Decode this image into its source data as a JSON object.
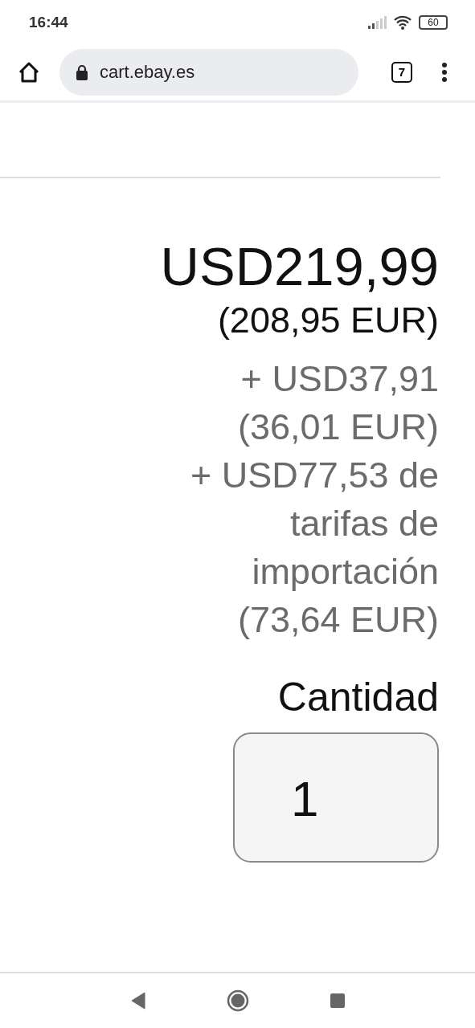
{
  "status_bar": {
    "time": "16:44",
    "battery": "60"
  },
  "browser": {
    "url": "cart.ebay.es",
    "tab_count": "7"
  },
  "item": {
    "price": "USD219,99",
    "price_converted": "(208,95 EUR)",
    "shipping": "+ USD37,91",
    "shipping_converted": "(36,01 EUR)",
    "import_fees": "+ USD77,53 de tarifas de importación",
    "import_fees_converted": "(73,64 EUR)",
    "quantity_label": "Cantidad",
    "quantity": "1"
  }
}
